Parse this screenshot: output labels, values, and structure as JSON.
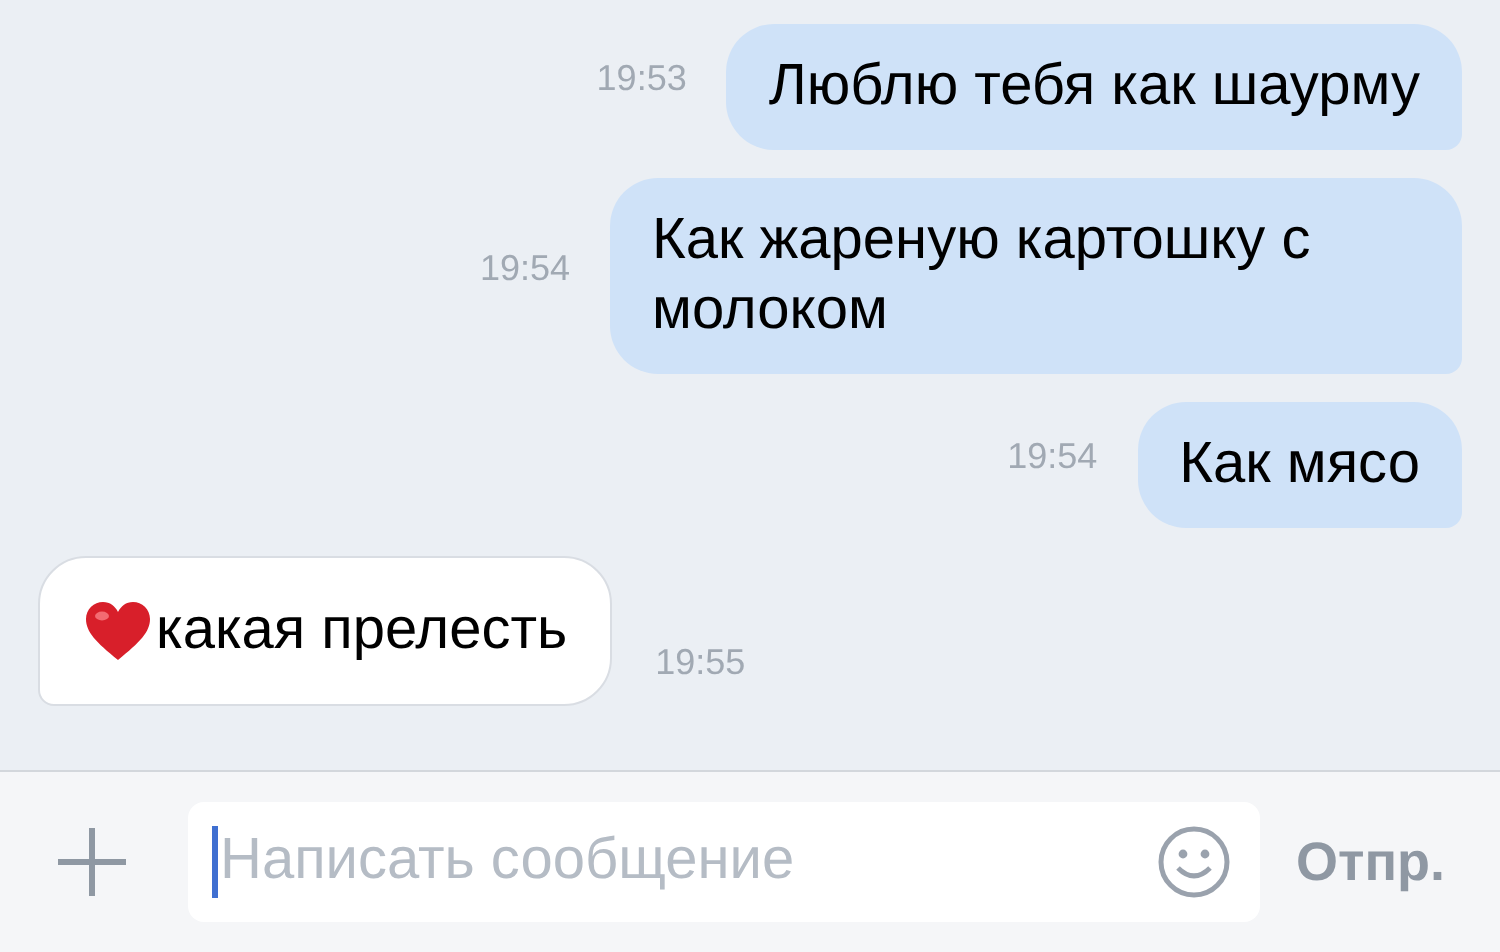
{
  "messages": [
    {
      "kind": "outgoing",
      "text": "Люблю тебя как шаурму",
      "time": "19:53",
      "heart": false
    },
    {
      "kind": "outgoing",
      "text": "Как жареную картошку с молоком",
      "time": "19:54",
      "heart": false
    },
    {
      "kind": "outgoing",
      "text": "Как мясо",
      "time": "19:54",
      "heart": false
    },
    {
      "kind": "incoming",
      "text": "какая прелесть",
      "time": "19:55",
      "heart": true
    }
  ],
  "composer": {
    "placeholder": "Написать сообщение",
    "send": "Отпр."
  }
}
